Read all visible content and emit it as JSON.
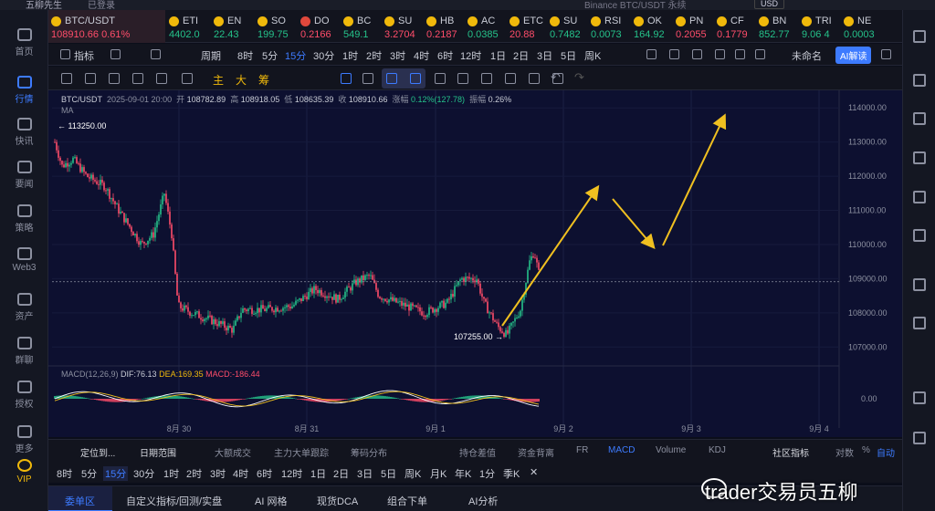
{
  "titlebar": {
    "app": "五柳先生",
    "badge": "已登录",
    "center": "Binance BTC/USDT 永续",
    "currency": "USD"
  },
  "sidebar": {
    "items": [
      {
        "label": "首页"
      },
      {
        "label": "行情"
      },
      {
        "label": "快讯"
      },
      {
        "label": "要闻"
      },
      {
        "label": "策略"
      },
      {
        "label": "Web3"
      },
      {
        "label": "资产"
      },
      {
        "label": "群聊"
      },
      {
        "label": "授权"
      },
      {
        "label": "更多"
      },
      {
        "label": "VIP"
      }
    ]
  },
  "tickers": [
    {
      "name": "BTC/USDT",
      "price": "108910.66",
      "change": "0.61%"
    },
    {
      "name": "ETI",
      "price": "4402.0"
    },
    {
      "name": "EN",
      "price": "22.43"
    },
    {
      "name": "SO",
      "price": "199.75"
    },
    {
      "name": "DO",
      "price": "0.2166"
    },
    {
      "name": "BC",
      "price": "549.1"
    },
    {
      "name": "SU",
      "price": "3.2704"
    },
    {
      "name": "HB",
      "price": "0.2187"
    },
    {
      "name": "AC",
      "price": "0.0385"
    },
    {
      "name": "ETC",
      "price": "20.88"
    },
    {
      "name": "SU",
      "price": "0.7482"
    },
    {
      "name": "RSI",
      "price": "0.0073"
    },
    {
      "name": "OK",
      "price": "164.92"
    },
    {
      "name": "PN",
      "price": "0.2055"
    },
    {
      "name": "CF",
      "price": "0.1779"
    },
    {
      "name": "BN",
      "price": "852.77"
    },
    {
      "name": "TRI",
      "price": "9.06 4"
    },
    {
      "name": "NE",
      "price": "0.0003"
    }
  ],
  "toolbar1": {
    "indicator": "指标",
    "period": "周期",
    "periods": [
      "8时",
      "5分",
      "15分",
      "30分",
      "1时",
      "2时",
      "3时",
      "4时",
      "6时",
      "12时",
      "1日",
      "2日",
      "3日",
      "5日",
      "周K"
    ],
    "selected_period": "15分",
    "reauth": "未命名",
    "ai": "AI解读"
  },
  "toolbar2": {
    "main": "主",
    "big": "大",
    "chips": "筹"
  },
  "chart_legend": {
    "symbol": "BTC/USDT",
    "time": "2025-09-01 20:00",
    "open_label": "开",
    "open": "108782.89",
    "high_label": "高",
    "high": "108918.05",
    "low_label": "低",
    "low": "108635.39",
    "close_label": "收",
    "close": "108910.66",
    "chg_label": "涨幅",
    "chg": "0.12%(127.78)",
    "amp_label": "振幅",
    "amp": "0.26%",
    "ma": "MA"
  },
  "macd": {
    "label": "MACD(12,26,9)",
    "dif": "DIF:76.13",
    "dea": "DEA:169.35",
    "macd": "MACD:-186.44"
  },
  "chart_data": {
    "type": "candlestick",
    "y_ticks": [
      "114000.00",
      "113000.00",
      "112000.00",
      "111000.00",
      "110000.00",
      "109000.00",
      "108000.00",
      "107000.00"
    ],
    "ylim": [
      106500,
      114300
    ],
    "x_ticks": [
      "8月 30",
      "8月 31",
      "9月 1",
      "9月 2",
      "9月 3",
      "9月 4"
    ],
    "high_annotation": "113250.00",
    "low_annotation": "107255.00",
    "last_price": 108910.66,
    "macd_zero": "0.00"
  },
  "bottom1": {
    "locate": "定位到...",
    "date_range": "日期范围",
    "items": [
      "大额成交",
      "主力大单跟踪",
      "筹码分布",
      "持仓差值",
      "资金背离",
      "FR",
      "MACD",
      "Volume",
      "KDJ"
    ],
    "community": "社区指标",
    "log": "对数",
    "pct": "%",
    "auto": "自动"
  },
  "bottom2": {
    "items": [
      "8时",
      "5分",
      "15分",
      "30分",
      "1时",
      "2时",
      "3时",
      "4时",
      "6时",
      "12时",
      "1日",
      "2日",
      "3日",
      "5日",
      "周K",
      "月K",
      "年K",
      "1分",
      "季K",
      "✕"
    ],
    "selected": "15分"
  },
  "bottom3": {
    "items": [
      "委单区",
      "自定义指标/回测/实盘",
      "AI 网格",
      "现货DCA",
      "组合下单",
      "AI分析"
    ]
  },
  "watermark": "trader交易员五柳"
}
